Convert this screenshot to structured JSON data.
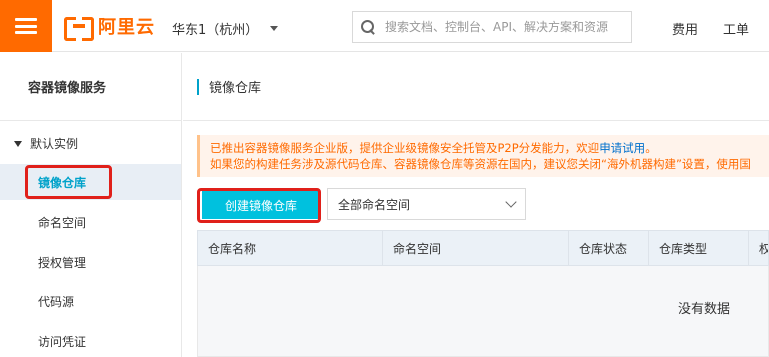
{
  "topbar": {
    "logo_text": "阿里云",
    "region": "华东1（杭州）",
    "search_placeholder": "搜索文档、控制台、API、解决方案和资源",
    "links": [
      "费用",
      "工单"
    ]
  },
  "sidebar": {
    "title": "容器镜像服务",
    "group": "默认实例",
    "items": [
      {
        "label": "镜像仓库",
        "active": true
      },
      {
        "label": "命名空间",
        "active": false
      },
      {
        "label": "授权管理",
        "active": false
      },
      {
        "label": "代码源",
        "active": false
      },
      {
        "label": "访问凭证",
        "active": false
      }
    ]
  },
  "main": {
    "page_title": "镜像仓库",
    "notice": {
      "line1_prefix": "已推出容器镜像服务企业版，提供企业级镜像安全托管及P2P分发能力，欢迎",
      "line1_link": "申请试用",
      "line1_suffix": "。",
      "line2": "如果您的构建任务涉及源代码仓库、容器镜像仓库等资源在国内，建议您关闭“海外机器构建”设置，使用国"
    },
    "create_button": "创建镜像仓库",
    "namespace_select": "全部命名空间",
    "table": {
      "columns": [
        "仓库名称",
        "命名空间",
        "仓库状态",
        "仓库类型",
        "权"
      ],
      "empty_text": "没有数据"
    }
  },
  "colors": {
    "brand": "#ff6a00",
    "accent": "#00c1de",
    "highlight_box": "#e0201a"
  }
}
